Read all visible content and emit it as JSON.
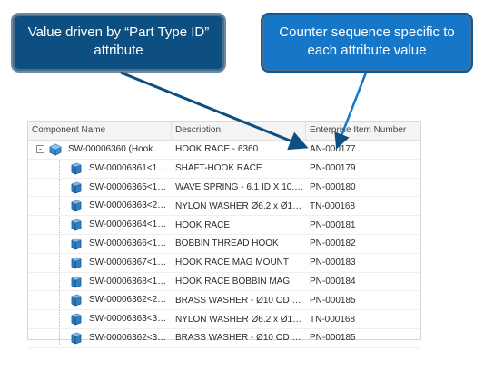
{
  "callouts": {
    "left": {
      "line1": "Value driven by “Part Type ID”",
      "line2": "attribute"
    },
    "right": {
      "line1": "Counter sequence specific to",
      "line2": "each attribute value"
    }
  },
  "colors": {
    "callout_left": "#0d4f80",
    "callout_right": "#1677c8",
    "arrow": "#0d4f80"
  },
  "grid": {
    "headers": [
      "Component Name",
      "Description",
      "Enterprise Item Number"
    ],
    "root": {
      "expander": "-",
      "name": "SW-00006360 (Hook…",
      "description": "HOOK RACE - 6360",
      "item_number": "AN-000177",
      "icon": "assembly-icon"
    },
    "children": [
      {
        "name": "SW-00006361<1…",
        "description": "SHAFT-HOOK RACE",
        "item_number": "PN-000179"
      },
      {
        "name": "SW-00006365<1…",
        "description": "WAVE SPRING - 6.1 ID X 10.…",
        "item_number": "PN-000180"
      },
      {
        "name": "SW-00006363<2…",
        "description": "NYLON WASHER Ø6.2 x Ø1…",
        "item_number": "TN-000168"
      },
      {
        "name": "SW-00006364<1…",
        "description": "HOOK RACE",
        "item_number": "PN-000181"
      },
      {
        "name": "SW-00006366<1…",
        "description": "BOBBIN THREAD HOOK",
        "item_number": "PN-000182"
      },
      {
        "name": "SW-00006367<1…",
        "description": "HOOK RACE MAG MOUNT",
        "item_number": "PN-000183"
      },
      {
        "name": "SW-00006368<1…",
        "description": "HOOK RACE BOBBIN MAG",
        "item_number": "PN-000184"
      },
      {
        "name": "SW-00006362<2…",
        "description": "BRASS WASHER - Ø10 OD …",
        "item_number": "PN-000185"
      },
      {
        "name": "SW-00006363<3…",
        "description": "NYLON WASHER Ø6.2 x Ø1…",
        "item_number": "TN-000168"
      },
      {
        "name": "SW-00006362<3…",
        "description": "BRASS WASHER - Ø10 OD …",
        "item_number": "PN-000185"
      }
    ],
    "child_icon": "part-icon"
  }
}
